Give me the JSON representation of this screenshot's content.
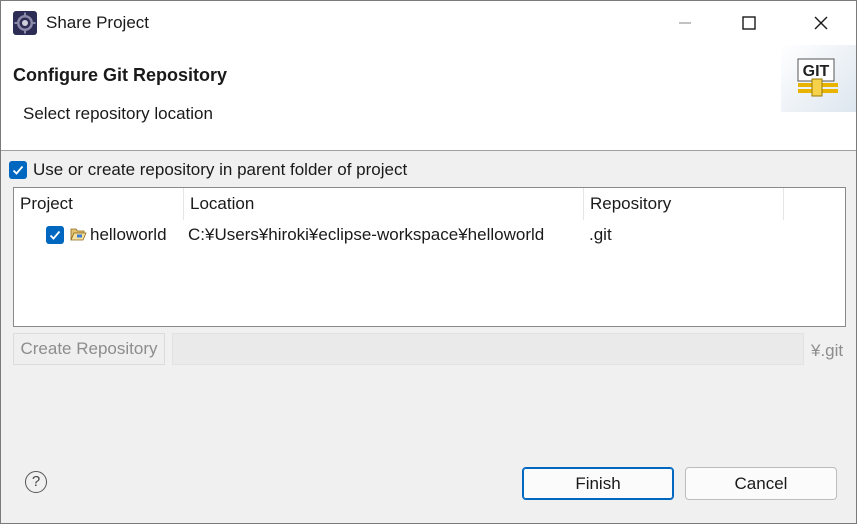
{
  "window": {
    "title": "Share Project",
    "icon": "eclipse-gear-icon"
  },
  "banner": {
    "title": "Configure Git Repository",
    "subtitle": "Select repository location",
    "logo_text": "GIT"
  },
  "parent_option": {
    "label": "Use or create repository in parent folder of project",
    "checked": true
  },
  "table": {
    "headers": {
      "project": "Project",
      "location": "Location",
      "repository": "Repository"
    },
    "rows": [
      {
        "project": "helloworld",
        "location": "C:¥Users¥hiroki¥eclipse-workspace¥helloworld",
        "repository": ".git",
        "checked": true
      }
    ]
  },
  "create": {
    "button_label": "Create Repository",
    "path_value": "",
    "suffix": "¥.git"
  },
  "footer": {
    "help_label": "?",
    "finish_label": "Finish",
    "cancel_label": "Cancel"
  },
  "colors": {
    "accent": "#0067c0",
    "disabled_text": "#8d8d8d"
  }
}
